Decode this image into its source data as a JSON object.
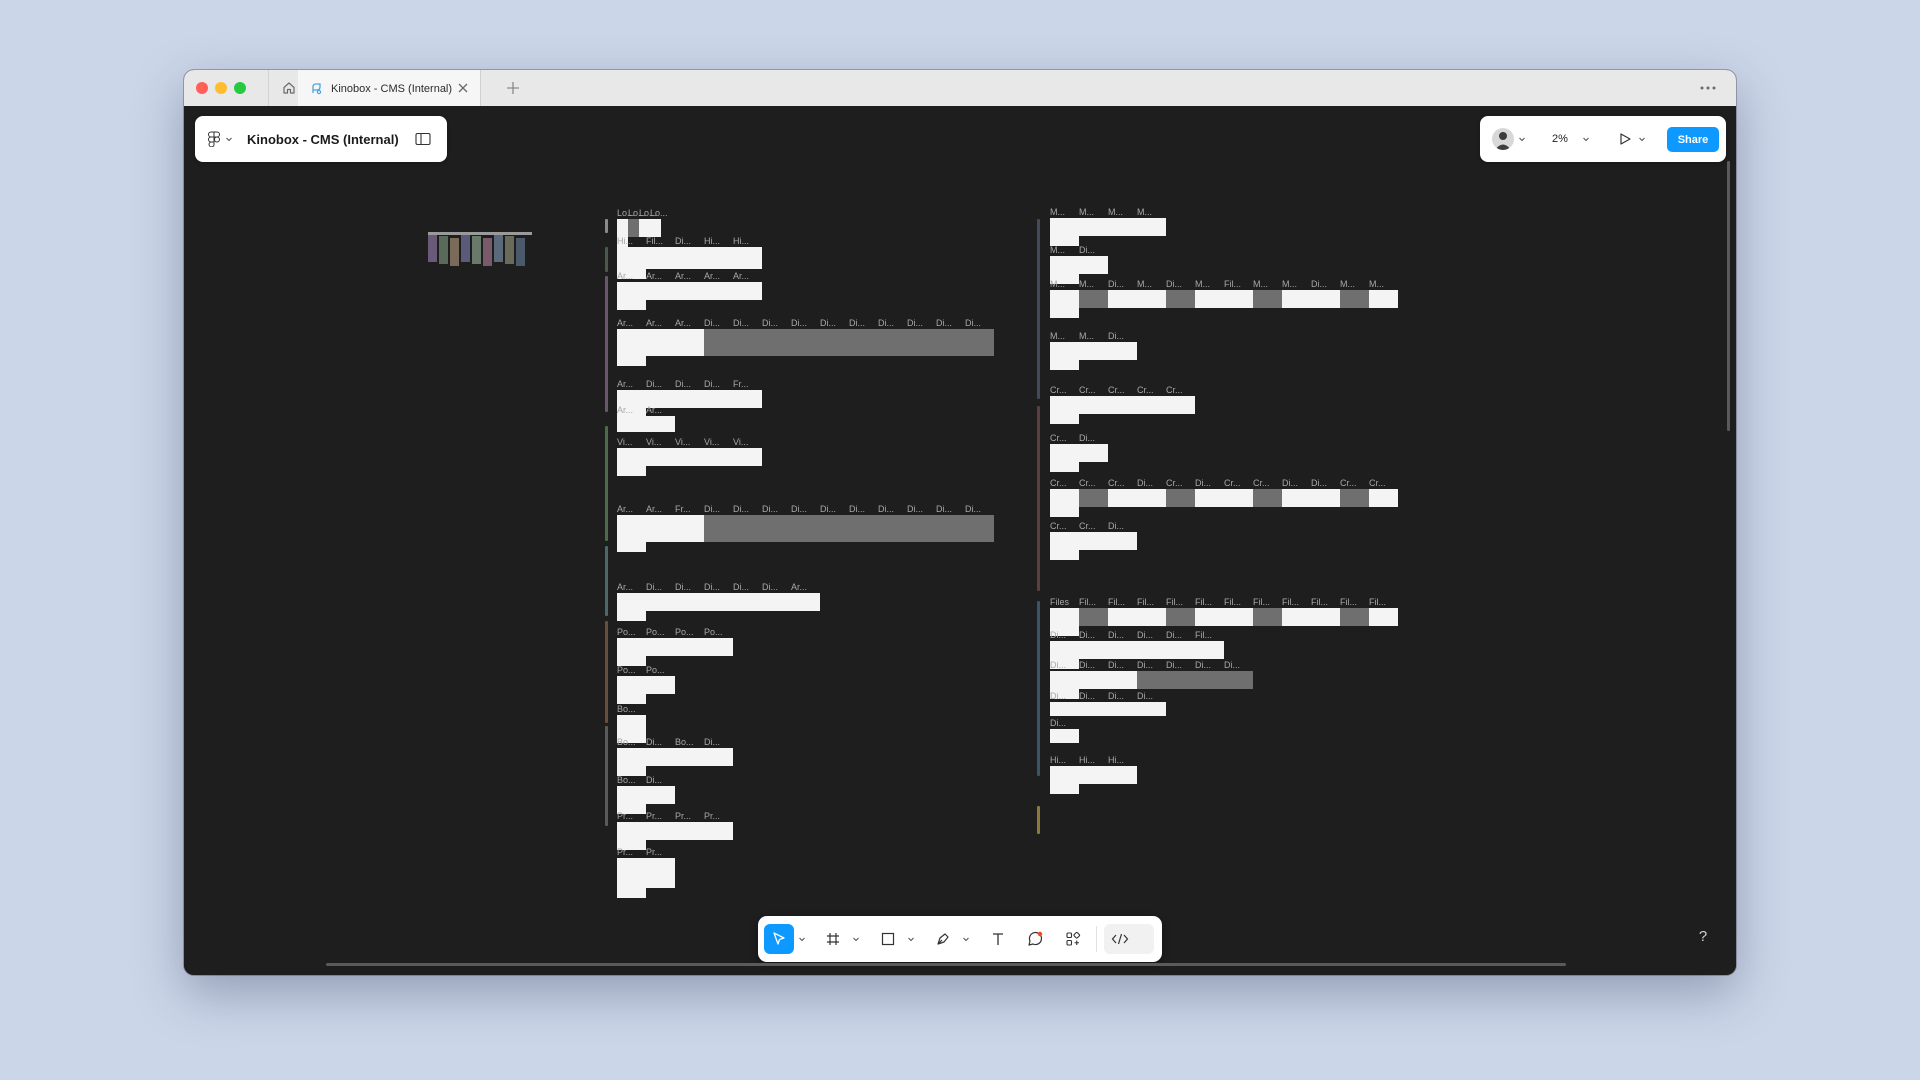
{
  "window": {
    "tab_title": "Kinobox - CMS (Internal)",
    "traffic_lights": [
      "#ff5f57",
      "#febc2e",
      "#28c840"
    ]
  },
  "file": {
    "name": "Kinobox - CMS (Internal)"
  },
  "header": {
    "zoom": "2%",
    "share_label": "Share"
  },
  "toolbar": {
    "tools": [
      "move-tool",
      "frame-tool",
      "shape-tool",
      "pen-tool",
      "text-tool",
      "comment-tool",
      "actions-tool",
      "dev-mode-toggle"
    ],
    "active_tool": "move-tool"
  },
  "help_label": "?",
  "colors": {
    "accent": "#0d99ff",
    "canvas": "#1e1e1e",
    "desktop": "#ccd6e9"
  },
  "canvas_labels": {
    "left": [
      [
        "Lo...",
        "Lo...",
        "Lo...",
        "Lo..."
      ],
      [
        "Hi...",
        "Fil...",
        "Di...",
        "Hi...",
        "Hi..."
      ],
      [
        "Ar...",
        "Ar...",
        "Ar...",
        "Ar...",
        "Ar..."
      ],
      [
        "Ar...",
        "Ar...",
        "Ar...",
        "Di...",
        "Di...",
        "Di...",
        "Di...",
        "Di...",
        "Di...",
        "Di...",
        "Di...",
        "Di...",
        "Di..."
      ],
      [
        "Ar...",
        "Di...",
        "Di...",
        "Di...",
        "Fr..."
      ],
      [
        "Ar...",
        "Ar..."
      ],
      [
        "Vi...",
        "Vi...",
        "Vi...",
        "Vi...",
        "Vi..."
      ],
      [
        "Ar...",
        "Ar...",
        "Fr...",
        "Di...",
        "Di...",
        "Di...",
        "Di...",
        "Di...",
        "Di...",
        "Di...",
        "Di...",
        "Di...",
        "Di..."
      ],
      [
        "Ar...",
        "Di...",
        "Di...",
        "Di...",
        "Di...",
        "Di...",
        "Ar..."
      ],
      [
        "Po...",
        "Po...",
        "Po...",
        "Po..."
      ],
      [
        "Po...",
        "Po..."
      ],
      [
        "Bo..."
      ],
      [
        "Bo...",
        "Di...",
        "Bo...",
        "Di..."
      ],
      [
        "Bo...",
        "Di..."
      ],
      [
        "Pr...",
        "Pr...",
        "Pr...",
        "Pr..."
      ],
      [
        "Pr...",
        "Pr..."
      ]
    ],
    "right": [
      [
        "M...",
        "M...",
        "M...",
        "M..."
      ],
      [
        "M...",
        "Di..."
      ],
      [
        "M...",
        "M...",
        "Di...",
        "M...",
        "Di...",
        "M...",
        "Fil...",
        "M...",
        "M...",
        "Di...",
        "M...",
        "M..."
      ],
      [
        "M...",
        "M...",
        "Di..."
      ],
      [
        "Cr...",
        "Cr...",
        "Cr...",
        "Cr...",
        "Cr..."
      ],
      [
        "Cr...",
        "Di..."
      ],
      [
        "Cr...",
        "Cr...",
        "Cr...",
        "Di...",
        "Cr...",
        "Di...",
        "Cr...",
        "Cr...",
        "Di...",
        "Di...",
        "Cr...",
        "Cr..."
      ],
      [
        "Cr...",
        "Cr...",
        "Di..."
      ],
      [
        "Files",
        "Fil...",
        "Fil...",
        "Fil...",
        "Fil...",
        "Fil...",
        "Fil...",
        "Fil...",
        "Fil...",
        "Fil...",
        "Fil...",
        "Fil..."
      ],
      [
        "Di...",
        "Di...",
        "Di...",
        "Di...",
        "Di...",
        "Fil..."
      ],
      [
        "Di...",
        "Di...",
        "Di...",
        "Di...",
        "Di...",
        "Di...",
        "Di..."
      ],
      [
        "Di...",
        "Di...",
        "Di...",
        "Di..."
      ],
      [
        "Di..."
      ],
      [
        "Hi...",
        "Hi...",
        "Hi..."
      ]
    ]
  }
}
